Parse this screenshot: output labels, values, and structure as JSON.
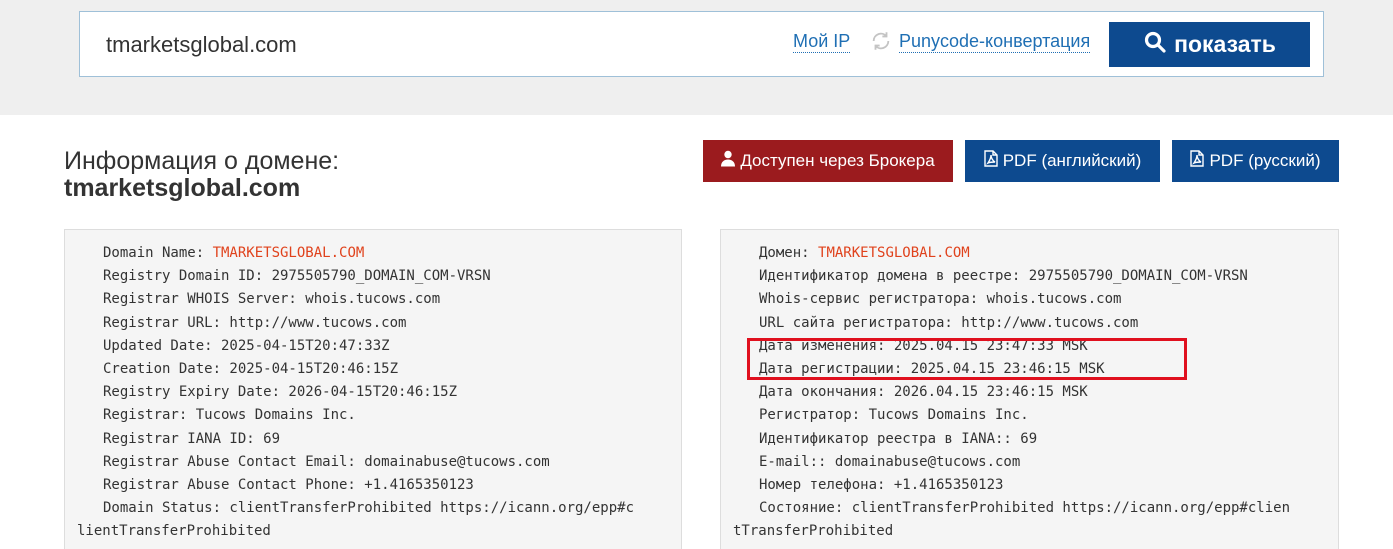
{
  "search": {
    "value": "tmarketsglobal.com",
    "link_myip": "Мой IP",
    "link_punycode": "Punycode-конвертация",
    "button": "показать"
  },
  "header": {
    "title_line1": "Информация о домене:",
    "title_line2": "tmarketsglobal.com"
  },
  "actions": {
    "broker": "Доступен через Брокера",
    "pdf_en": "PDF (английский)",
    "pdf_ru": "PDF (русский)"
  },
  "whois_en": [
    {
      "label": "Domain Name: ",
      "value": "TMARKETSGLOBAL.COM"
    },
    {
      "text": "Registry Domain ID: 2975505790_DOMAIN_COM-VRSN"
    },
    {
      "text": "Registrar WHOIS Server: whois.tucows.com"
    },
    {
      "text": "Registrar URL: http://www.tucows.com"
    },
    {
      "text": "Updated Date: 2025-04-15T20:47:33Z"
    },
    {
      "text": "Creation Date: 2025-04-15T20:46:15Z"
    },
    {
      "text": "Registry Expiry Date: 2026-04-15T20:46:15Z"
    },
    {
      "text": "Registrar: Tucows Domains Inc."
    },
    {
      "text": "Registrar IANA ID: 69"
    },
    {
      "text": "Registrar Abuse Contact Email: domainabuse@tucows.com"
    },
    {
      "text": "Registrar Abuse Contact Phone: +1.4165350123"
    },
    {
      "text": "Domain Status: clientTransferProhibited https://icann.org/epp#c"
    },
    {
      "text": "lientTransferProhibited",
      "wrap": true
    }
  ],
  "whois_ru": [
    {
      "label": "Домен: ",
      "value": "TMARKETSGLOBAL.COM"
    },
    {
      "text": "Идентификатор домена в реестре: 2975505790_DOMAIN_COM-VRSN"
    },
    {
      "text": "Whois-сервис регистратора: whois.tucows.com"
    },
    {
      "text": "URL сайта регистратора: http://www.tucows.com"
    },
    {
      "text": "Дата изменения: 2025.04.15 23:47:33 MSK"
    },
    {
      "text": "Дата регистрации: 2025.04.15 23:46:15 MSK"
    },
    {
      "text": "Дата окончания: 2026.04.15 23:46:15 MSK"
    },
    {
      "text": "Регистратор: Tucows Domains Inc."
    },
    {
      "text": "Идентификатор реестра в IANA:: 69"
    },
    {
      "text": "E-mail:: domainabuse@tucows.com"
    },
    {
      "text": "Номер телефона: +1.4165350123"
    },
    {
      "text": "Состояние: clientTransferProhibited https://icann.org/epp#clien"
    },
    {
      "text": "tTransferProhibited",
      "wrap": true
    }
  ],
  "colors": {
    "accent": "#0d4a8f",
    "broker": "#9b1b1e",
    "domain_highlight": "#e0421c",
    "annotation": "#e0101e"
  },
  "icons": {
    "search_button": "search-icon",
    "refresh": "refresh-icon",
    "broker": "user-icon",
    "pdf": "pdf-file-icon"
  }
}
